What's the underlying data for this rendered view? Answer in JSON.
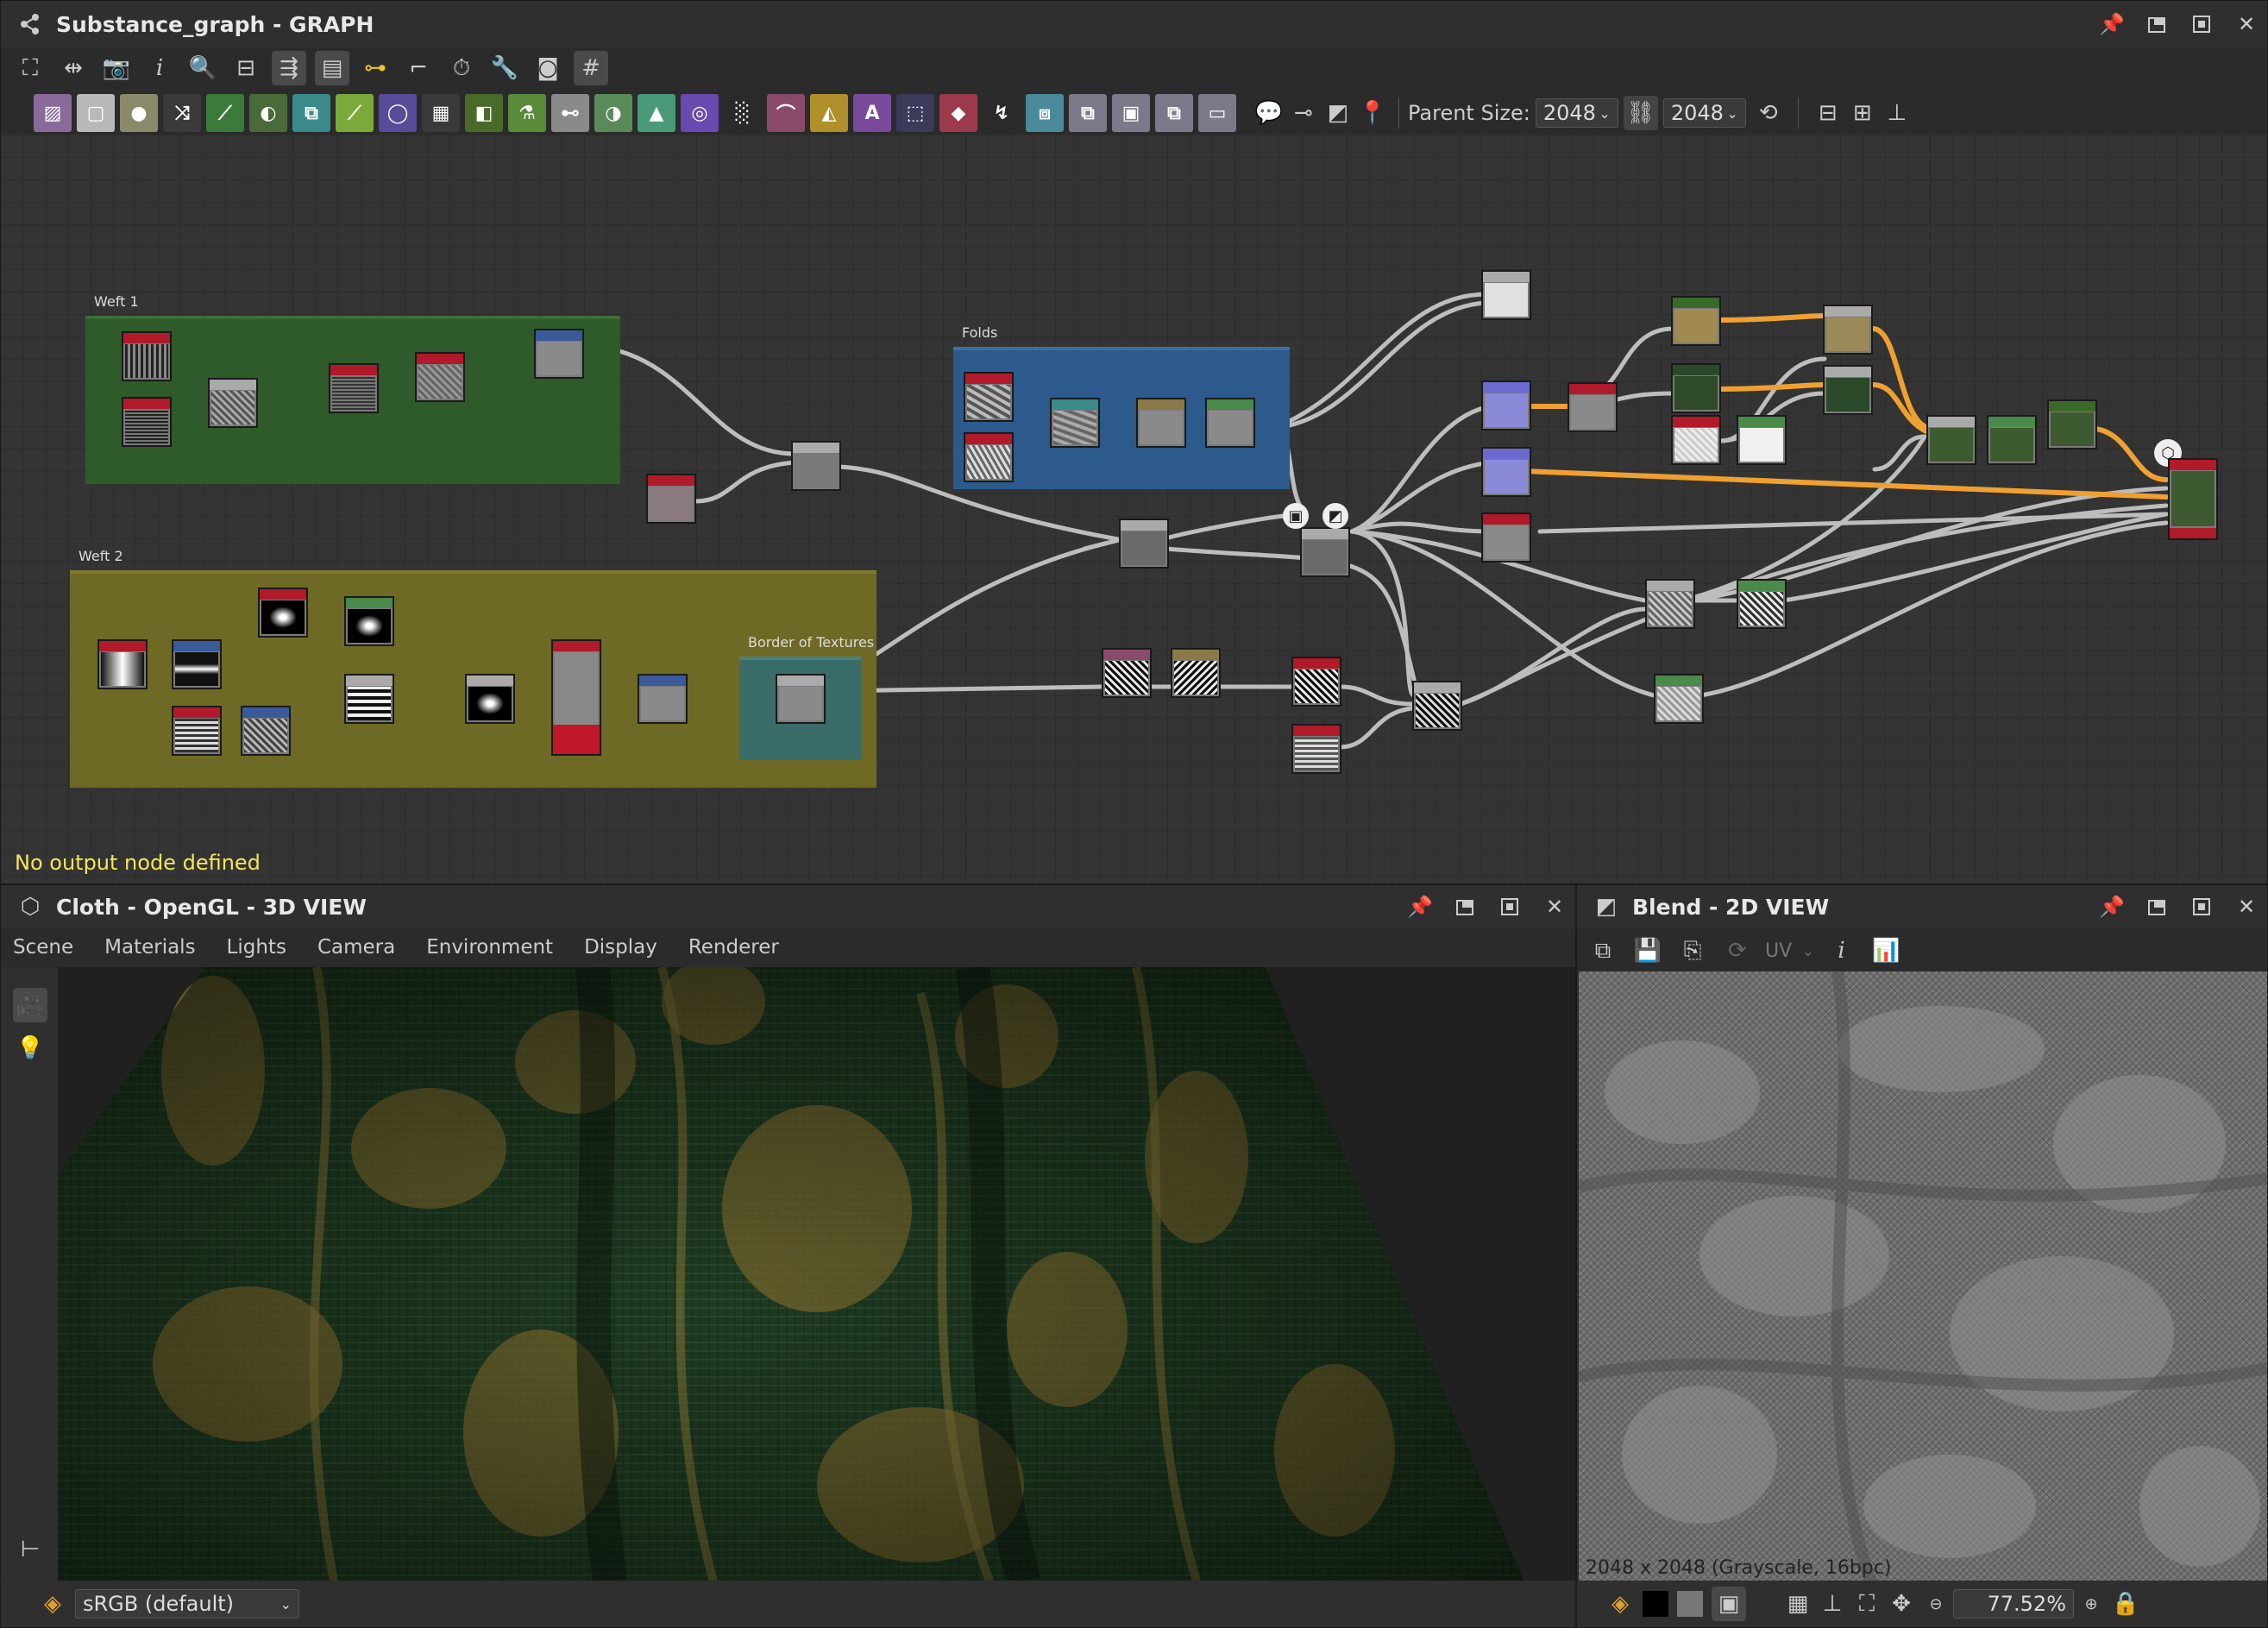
{
  "graph_panel": {
    "title": "Substance_graph - GRAPH",
    "parent_size_label": "Parent Size:",
    "parent_size_value": "2048",
    "parent_size_value2": "2048",
    "status": "No output node defined",
    "frames": {
      "weft1": "Weft 1",
      "weft2": "Weft 2",
      "folds": "Folds",
      "border": "Border of Textures"
    }
  },
  "view3d_panel": {
    "title": "Cloth - OpenGL - 3D VIEW",
    "menu": [
      "Scene",
      "Materials",
      "Lights",
      "Camera",
      "Environment",
      "Display",
      "Renderer"
    ],
    "colorspace": "sRGB (default)"
  },
  "view2d_panel": {
    "title": "Blend - 2D VIEW",
    "uv_label": "UV",
    "image_info": "2048 x 2048 (Grayscale, 16bpc)",
    "zoom": "77.52%"
  },
  "colors": {
    "accent_orange": "#f0a030",
    "frame_green": "#2f5a2a",
    "frame_olive": "#6e6a26",
    "frame_blue": "#2c5a8c",
    "frame_teal": "#3a6c6a",
    "status_yellow": "#f6e55a"
  }
}
